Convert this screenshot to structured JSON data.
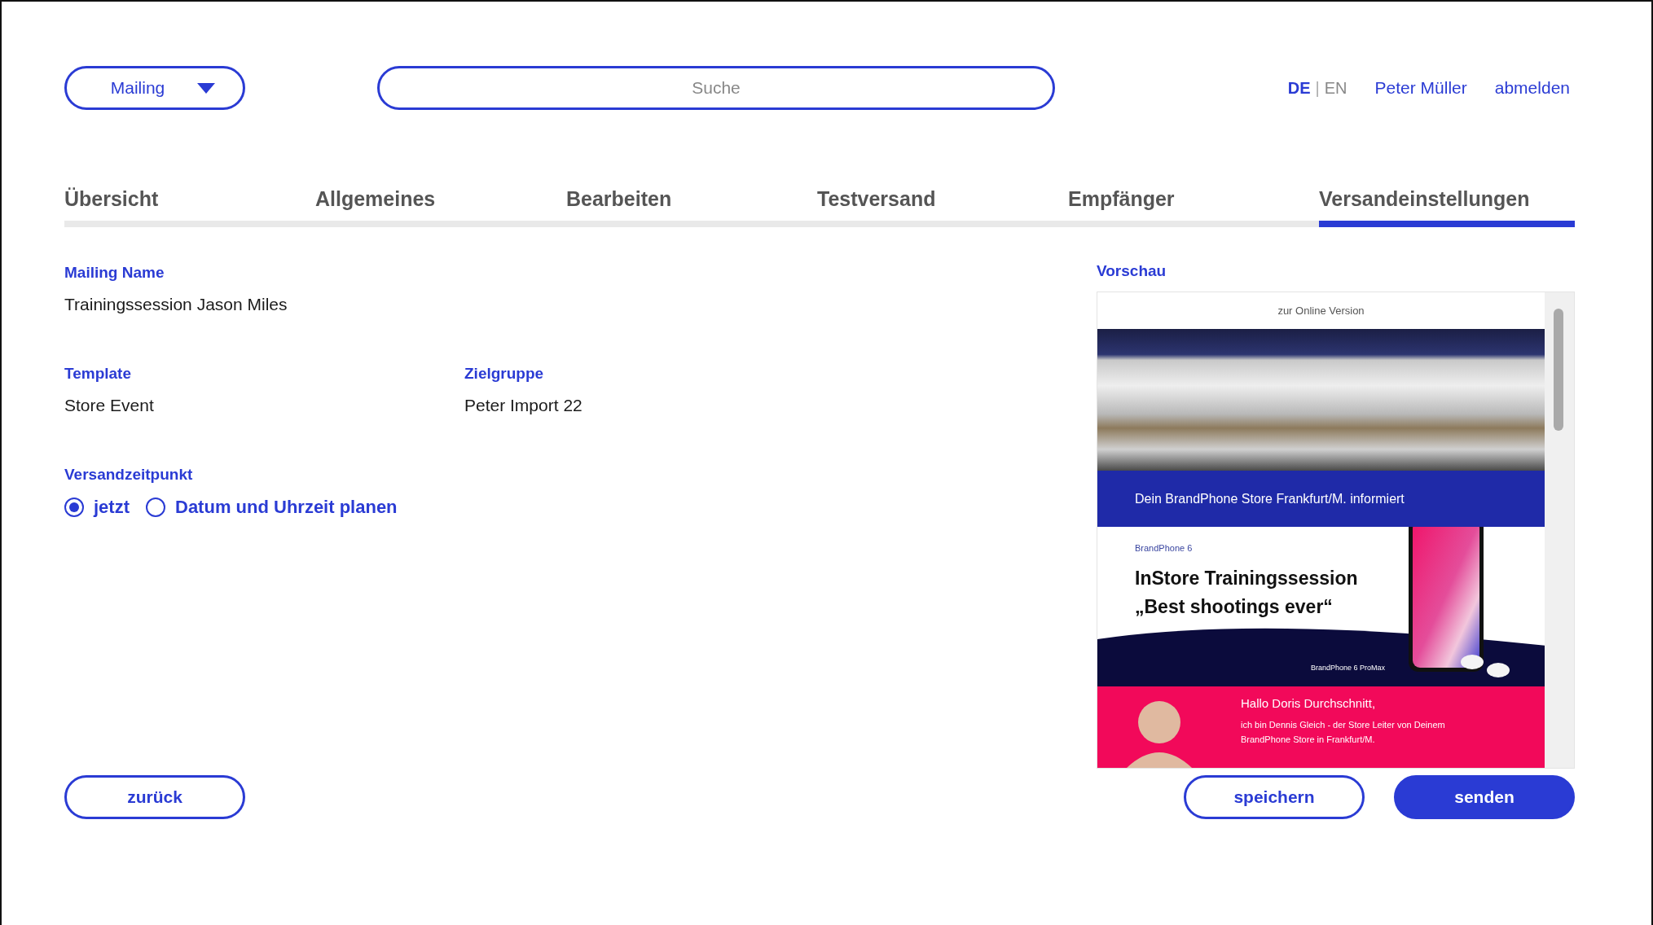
{
  "header": {
    "mailing_dropdown": "Mailing",
    "search": {
      "placeholder": "Suche"
    },
    "languages": [
      {
        "label": "DE",
        "selected": true
      },
      {
        "label": "EN",
        "selected": false
      }
    ],
    "separator": "|",
    "user": "Peter Müller",
    "logout": "abmelden"
  },
  "tabs": [
    {
      "label": "Übersicht",
      "selected": false
    },
    {
      "label": "Allgemeines",
      "selected": false
    },
    {
      "label": "Bearbeiten",
      "selected": false
    },
    {
      "label": "Testversand",
      "selected": false
    },
    {
      "label": "Empfänger",
      "selected": false
    },
    {
      "label": "Versandeinstellungen",
      "selected": true
    }
  ],
  "fields": [
    {
      "label": "Mailing Name",
      "value": "Trainingssession Jason Miles"
    },
    {
      "label": "Template",
      "value": "Store Event"
    },
    {
      "label": "Zielgruppe",
      "value": "Peter Import 22"
    }
  ],
  "send_time": {
    "label": "Versandzeitpunkt",
    "options": [
      {
        "label": "jetzt",
        "selected": true
      },
      {
        "label": "Datum und Uhrzeit planen",
        "selected": false
      }
    ]
  },
  "preview": {
    "title": "Vorschau",
    "email": {
      "online_link": "zur Online Version",
      "banner": "Dein BrandPhone Store Frankfurt/M. informiert",
      "eyebrow": "BrandPhone 6",
      "headline": "InStore Trainingssession „Best shootings ever“",
      "product_caption": "BrandPhone 6 ProMax",
      "greeting": "Hallo Doris Durchschnitt,",
      "body": "ich bin Dennis Gleich - der Store Leiter von Deinem BrandPhone Store in Frankfurt/M."
    }
  },
  "actions": [
    {
      "label": "zurück",
      "kind": "outline"
    },
    {
      "label": "speichern",
      "kind": "outline"
    },
    {
      "label": "senden",
      "kind": "primary"
    }
  ]
}
